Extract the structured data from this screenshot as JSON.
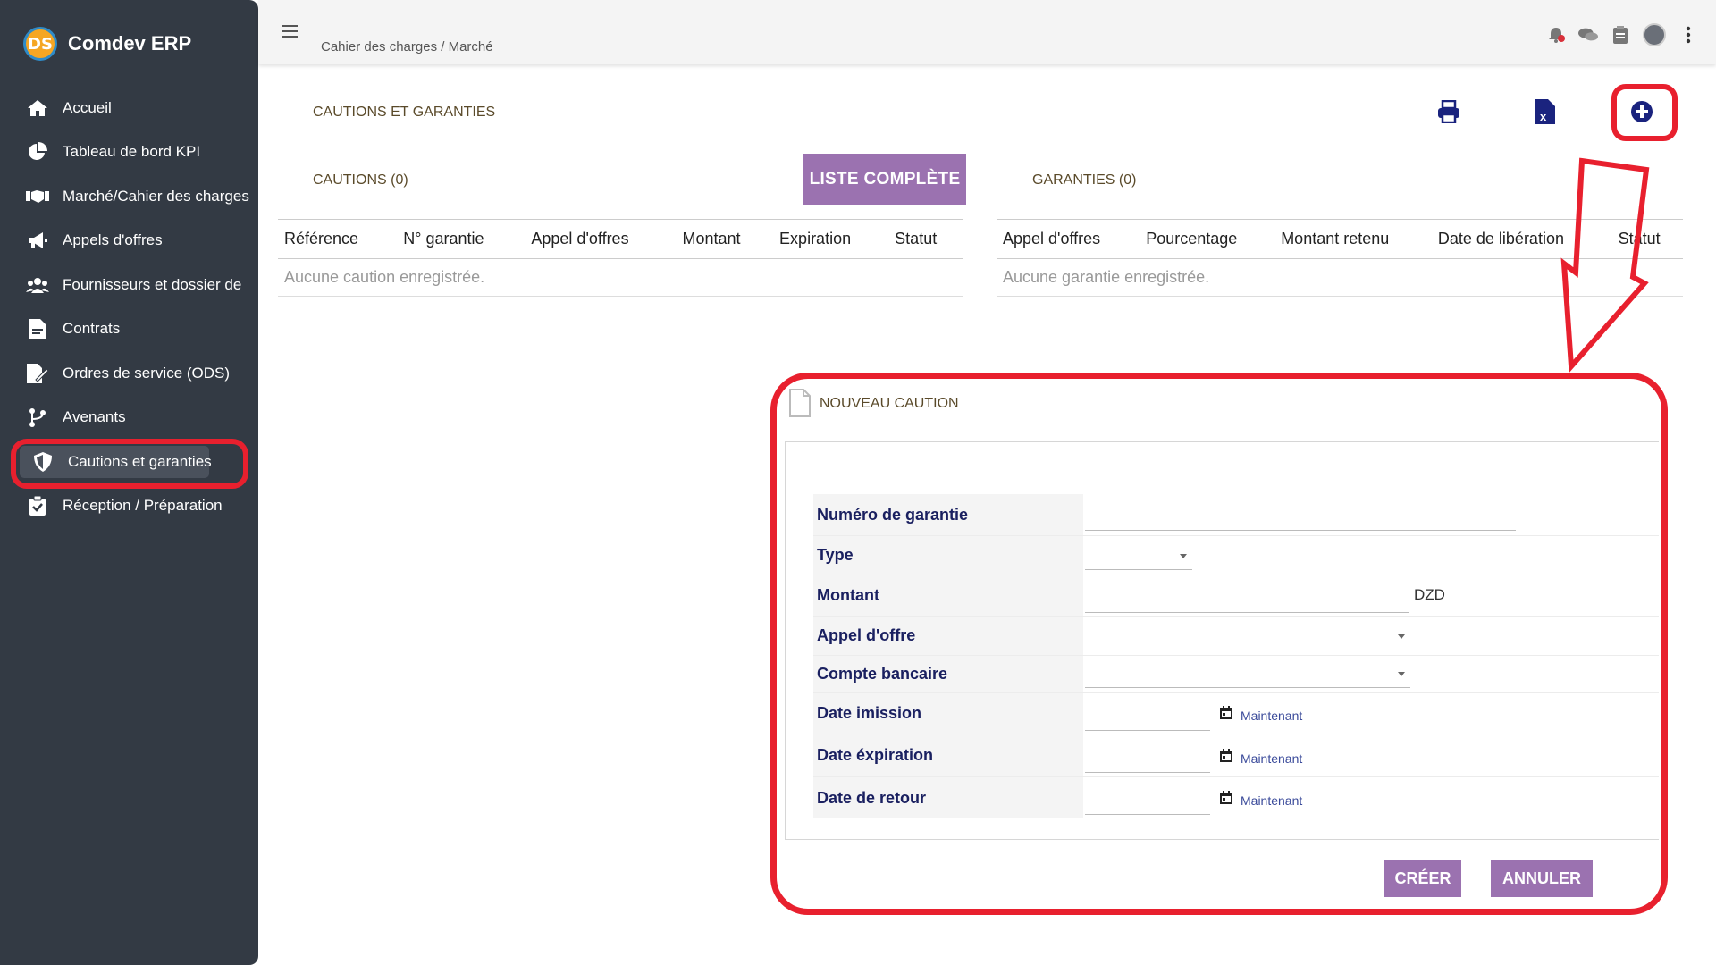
{
  "app": {
    "name": "Comdev ERP",
    "logo_text": "DS"
  },
  "sidebar": {
    "items": [
      {
        "label": "Accueil",
        "icon": "home-icon"
      },
      {
        "label": "Tableau de bord KPI",
        "icon": "pie-chart-icon"
      },
      {
        "label": "Marché/Cahier des charges",
        "icon": "handshake-icon"
      },
      {
        "label": "Appels d'offres",
        "icon": "megaphone-icon"
      },
      {
        "label": "Fournisseurs et dossier de",
        "icon": "users-icon"
      },
      {
        "label": "Contrats",
        "icon": "file-pdf-icon"
      },
      {
        "label": "Ordres de service (ODS)",
        "icon": "file-signature-icon"
      },
      {
        "label": "Avenants",
        "icon": "branch-icon"
      },
      {
        "label": "Cautions et garanties",
        "icon": "shield-icon",
        "active": true
      },
      {
        "label": "Réception / Préparation",
        "icon": "clipboard-check-icon"
      }
    ]
  },
  "header": {
    "breadcrumb": "Cahier des charges / Marché"
  },
  "page": {
    "title": "CAUTIONS ET GARANTIES"
  },
  "cautions": {
    "title": "CAUTIONS (0)",
    "list_button": "LISTE COMPLÈTE",
    "columns": [
      "Référence",
      "N° garantie",
      "Appel d'offres",
      "Montant",
      "Expiration",
      "Statut"
    ],
    "empty": "Aucune caution enregistrée."
  },
  "garanties": {
    "title": "GARANTIES (0)",
    "columns": [
      "Appel d'offres",
      "Pourcentage",
      "Montant retenu",
      "Date de libération",
      "Statut"
    ],
    "empty": "Aucune garantie enregistrée."
  },
  "form": {
    "title": "NOUVEAU CAUTION",
    "fields": {
      "numero": {
        "label": "Numéro de garantie",
        "value": ""
      },
      "type": {
        "label": "Type",
        "value": ""
      },
      "montant": {
        "label": "Montant",
        "value": "",
        "unit": "DZD"
      },
      "appel": {
        "label": "Appel d'offre",
        "value": ""
      },
      "compte": {
        "label": "Compte bancaire",
        "value": ""
      },
      "date_emission": {
        "label": "Date imission",
        "value": "",
        "now": "Maintenant"
      },
      "date_expiration": {
        "label": "Date éxpiration",
        "value": "",
        "now": "Maintenant"
      },
      "date_retour": {
        "label": "Date de retour",
        "value": "",
        "now": "Maintenant"
      }
    },
    "create_button": "CRÉER",
    "cancel_button": "ANNULER"
  },
  "colors": {
    "sidebar": "#333a44",
    "accent": "#9b72b0",
    "highlight": "#e8202e",
    "label": "#1a2060"
  }
}
